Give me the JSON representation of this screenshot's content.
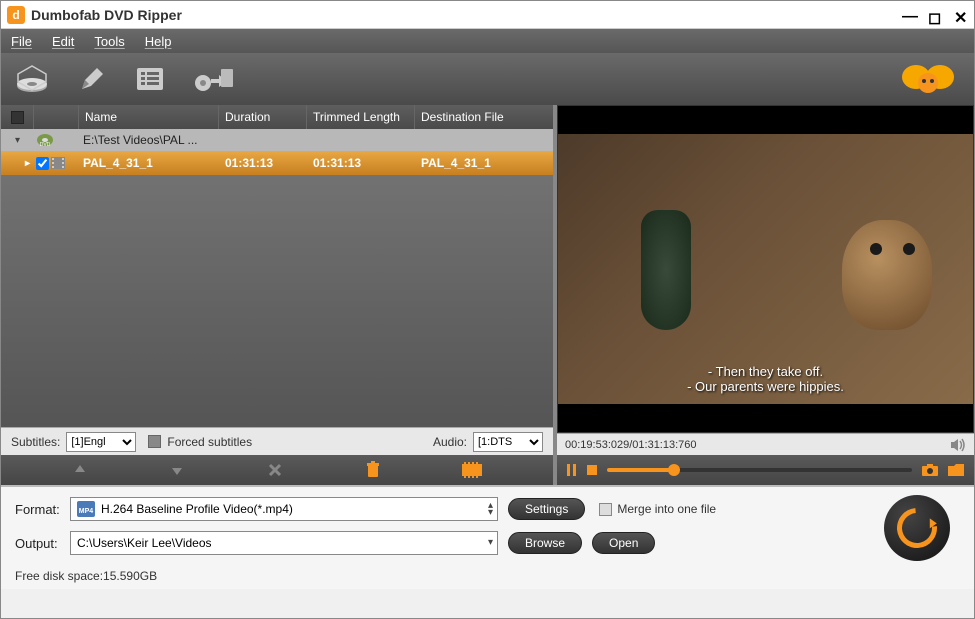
{
  "window": {
    "title": "Dumbofab DVD Ripper"
  },
  "menu": {
    "file": "File",
    "edit": "Edit",
    "tools": "Tools",
    "help": "Help"
  },
  "table": {
    "headers": {
      "name": "Name",
      "duration": "Duration",
      "trimmed": "Trimmed Length",
      "dest": "Destination File"
    },
    "folder_name": "E:\\Test Videos\\PAL ...",
    "file": {
      "name": "PAL_4_31_1",
      "duration": "01:31:13",
      "trimmed": "01:31:13",
      "dest": "PAL_4_31_1"
    }
  },
  "subbar": {
    "subtitles_label": "Subtitles:",
    "subtitles_value": "[1]Engl",
    "forced_label": "Forced subtitles",
    "audio_label": "Audio:",
    "audio_value": "[1:DTS"
  },
  "preview": {
    "sub_line1": "- Then they take off.",
    "sub_line2": "- Our parents were hippies.",
    "time": "00:19:53:029/01:31:13:760"
  },
  "bottom": {
    "format_label": "Format:",
    "format_value": "H.264 Baseline Profile Video(*.mp4)",
    "settings_btn": "Settings",
    "merge_label": "Merge into one file",
    "output_label": "Output:",
    "output_value": "C:\\Users\\Keir Lee\\Videos",
    "browse_btn": "Browse",
    "open_btn": "Open",
    "status": "Free disk space:15.590GB"
  }
}
